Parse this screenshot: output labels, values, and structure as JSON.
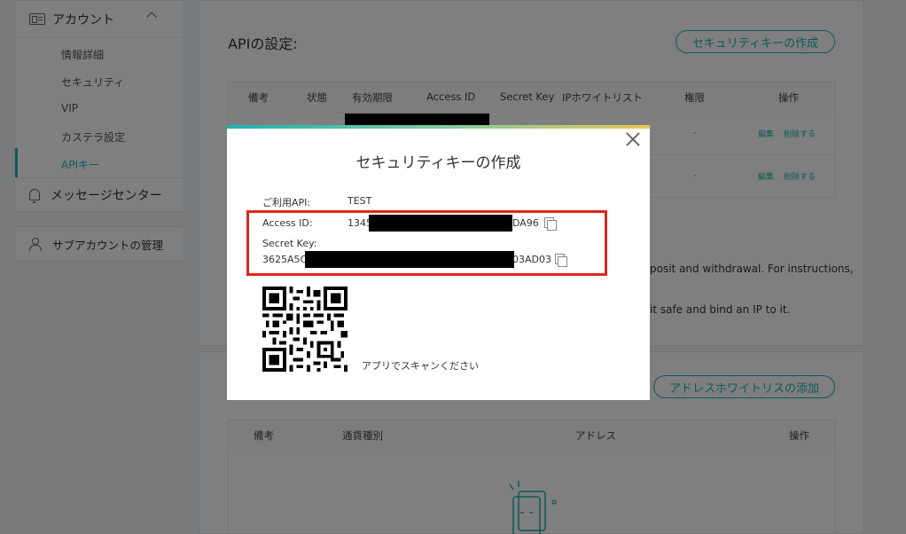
{
  "sidebar": {
    "account": {
      "label": "アカウント",
      "items": [
        {
          "label": "情報詳細"
        },
        {
          "label": "セキュリティ"
        },
        {
          "label": "VIP"
        },
        {
          "label": "カステラ設定"
        },
        {
          "label": "APIキー",
          "active": true
        }
      ]
    },
    "message_center": "メッセージセンター",
    "sub_account": "サブアカウントの管理"
  },
  "api_settings": {
    "title": "APIの設定:",
    "create_key_button": "セキュリティキーの作成",
    "columns": [
      "備考",
      "状態",
      "有効期限",
      "Access ID",
      "Secret Key",
      "IPホワイトリスト",
      "権限",
      "操作"
    ],
    "rows": [
      {
        "permission": "-",
        "edit": "編集",
        "delete": "削除する"
      },
      {
        "permission": "-",
        "edit": "編集",
        "delete": "削除する"
      }
    ],
    "note_fragments": [
      "posit and withdrawal. For instructions,",
      "it safe and bind an IP to it."
    ]
  },
  "address_whitelist": {
    "add_button": "アドレスホワイトリスの添加",
    "columns": [
      "備考",
      "通貨種別",
      "アドレス",
      "操作"
    ]
  },
  "modal": {
    "title": "セキュリティキーの作成",
    "api_label": "ご利用API:",
    "api_value": "TEST",
    "access_id_label": "Access ID:",
    "access_id_prefix": "1345",
    "access_id_suffix": "DA96",
    "secret_key_label": "Secret Key:",
    "secret_key_prefix": "3625A5C4",
    "secret_key_suffix": "03AD03",
    "qr_caption": "アプリでスキャンください"
  },
  "colors": {
    "accent": "#19b4b2",
    "highlight": "#e0261f"
  }
}
